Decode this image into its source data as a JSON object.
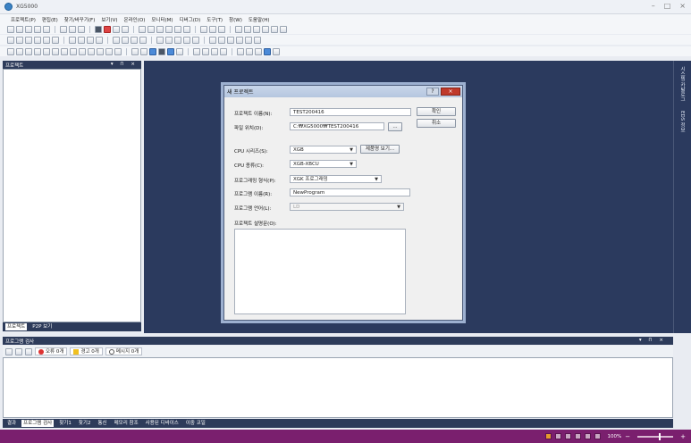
{
  "window": {
    "title": "XG5000",
    "controls": [
      "–",
      "□",
      "×"
    ]
  },
  "menu": [
    "프로젝트(P)",
    "편집(E)",
    "찾기/바꾸기(F)",
    "보기(V)",
    "온라인(O)",
    "모니터(M)",
    "디버그(D)",
    "도구(T)",
    "창(W)",
    "도움말(H)"
  ],
  "project_pane": {
    "title": "프로젝트",
    "pane_buttons": "▾ ⊓ ×",
    "tabs": [
      "프로젝트",
      "P2P 보기"
    ]
  },
  "side_tabs": [
    "시스템 카탈로그",
    "EDS 정보"
  ],
  "dialog": {
    "title": "새 프로젝트",
    "help_button": "?",
    "close_button": "×",
    "ok_button": "확인",
    "cancel_button": "취소",
    "browse_button": "...",
    "product_info_button": "제품명 보기...",
    "project_name_label": "프로젝트 이름(N):",
    "project_name_value": "TEST200416",
    "file_location_label": "파일 위치(D):",
    "file_location_value": "C:₩XG5000₩TEST200416",
    "cpu_series_label": "CPU 시리즈(S):",
    "cpu_series_value": "XGB",
    "cpu_type_label": "CPU 종류(C):",
    "cpu_type_value": "XGB-XBCU",
    "program_type_label": "프로그래밍 형식(P):",
    "program_type_value": "XGK 프로그래밍",
    "program_name_label": "프로그램 이름(R):",
    "program_name_value": "NewProgram",
    "program_lang_label": "프로그램 언어(L):",
    "program_lang_value": "LD",
    "description_label": "프로젝트 설명문(O):"
  },
  "output_pane": {
    "title": "프로그램 검사",
    "pane_buttons": "▾ ⊓ ×",
    "filters": {
      "errors": "오류 0개",
      "warnings": "경고 0개",
      "messages": "메시지 0개"
    },
    "tabs": [
      "결과",
      "프로그램 검사",
      "찾기1",
      "찾기2",
      "통신",
      "메모리 참조",
      "사용된 디바이스",
      "이중 코일"
    ]
  },
  "statusbar": {
    "zoom": "100%",
    "zoom_level_fraction": 0.6
  },
  "colors": {
    "accent": "#7a1f6e",
    "pane_header": "#2d3b5a",
    "workspace": "#2b3a5e"
  }
}
